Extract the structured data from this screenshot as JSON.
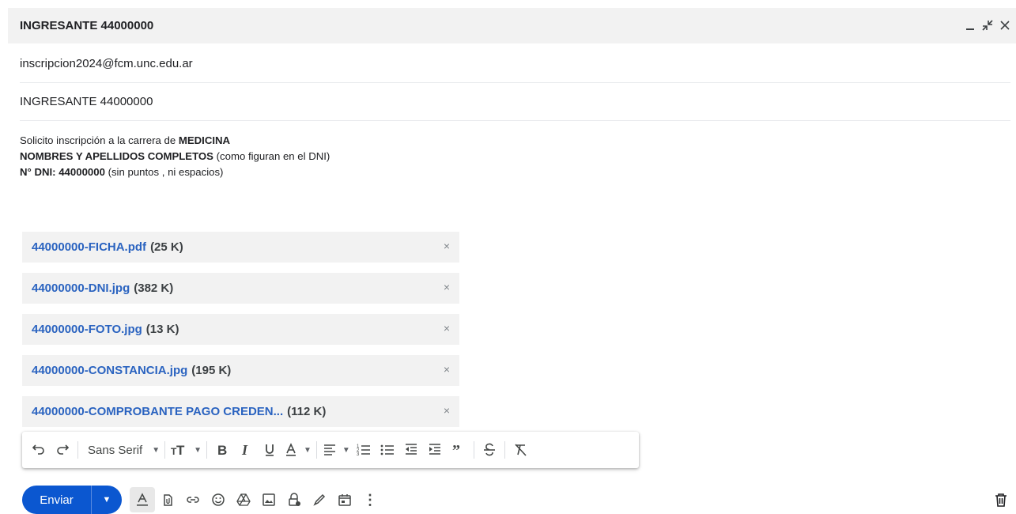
{
  "window": {
    "title": "INGRESANTE 44000000",
    "controls": [
      "minimize",
      "exit-fullscreen",
      "close"
    ]
  },
  "to": {
    "value": "inscripcion2024@fcm.unc.edu.ar"
  },
  "subject": {
    "value": "INGRESANTE 44000000"
  },
  "body": {
    "line1_prefix": "Solicito inscripción a la carrera de ",
    "line1_bold": "MEDICINA",
    "line2_bold": "NOMBRES Y APELLIDOS COMPLETOS",
    "line2_suffix": " (como figuran en el DNI)",
    "line3_bold": "N° DNI: 44000000",
    "line3_suffix": " (sin puntos , ni espacios)"
  },
  "attachments": [
    {
      "name": "44000000-FICHA.pdf",
      "size": "(25 K)"
    },
    {
      "name": "44000000-DNI.jpg",
      "size": "(382 K)"
    },
    {
      "name": "44000000-FOTO.jpg",
      "size": "(13 K)"
    },
    {
      "name": "44000000-CONSTANCIA.jpg",
      "size": "(195 K)"
    },
    {
      "name": "44000000-COMPROBANTE PAGO CREDEN...",
      "size": " (112 K)"
    }
  ],
  "attachment_close_glyph": "×",
  "format_bar": {
    "font": "Sans Serif"
  },
  "bottom": {
    "send_label": "Enviar",
    "more_glyph": "⋮"
  },
  "colors": {
    "send_blue": "#0b57d0",
    "link_blue": "#2a63c0",
    "chip_bg": "#f2f2f2",
    "header_bg": "#f2f2f2"
  }
}
